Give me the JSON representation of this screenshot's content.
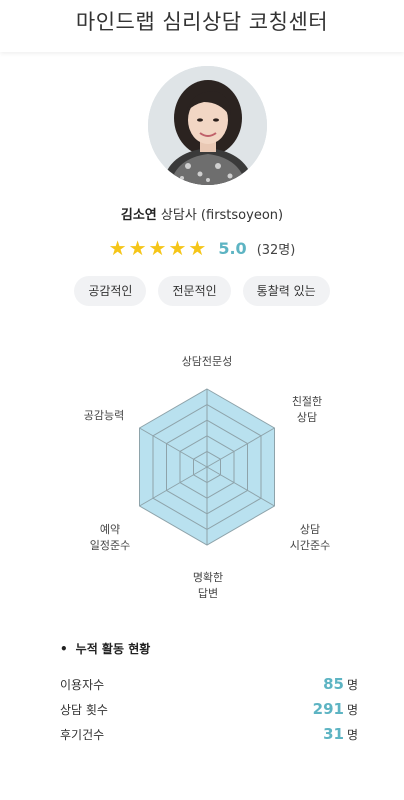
{
  "header": {
    "title": "마인드랩 심리상담 코칭센터"
  },
  "profile": {
    "name": "김소연",
    "role": "상담사 (firstsoyeon)",
    "rating": "5.0",
    "rating_count": "(32명)",
    "stars": 5
  },
  "tags": [
    "공감적인",
    "전문적인",
    "통찰력 있는"
  ],
  "radar": {
    "axes": [
      {
        "line1": "상담전문성",
        "line2": ""
      },
      {
        "line1": "친절한",
        "line2": "상담"
      },
      {
        "line1": "상담",
        "line2": "시간준수"
      },
      {
        "line1": "명확한",
        "line2": "답변"
      },
      {
        "line1": "예약",
        "line2": "일정준수"
      },
      {
        "line1": "공감능력",
        "line2": ""
      }
    ],
    "fill_color": "#b9e1ef",
    "grid_color": "#8ea3aa"
  },
  "stats": {
    "title": "누적 활동 현황",
    "rows": [
      {
        "label": "이용자수",
        "value": "85",
        "unit": "명"
      },
      {
        "label": "상담 횟수",
        "value": "291",
        "unit": "명"
      },
      {
        "label": "후기건수",
        "value": "31",
        "unit": "명"
      }
    ]
  }
}
